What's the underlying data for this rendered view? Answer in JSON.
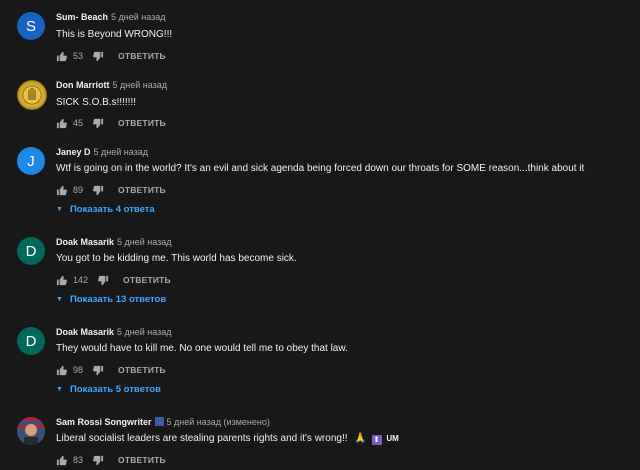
{
  "colors": {
    "background": "#181818",
    "link": "#3ea6ff",
    "avatar_sum": "#1565c0",
    "avatar_janey": "#1e88e5",
    "avatar_doak": "#00695c"
  },
  "comments": [
    {
      "avatar_letter": "S",
      "author": "Sum- Beach",
      "time": "5 дней назад",
      "text": "This is Beyond WRONG!!!",
      "likes": "53",
      "reply_label": "ОТВЕТИТЬ"
    },
    {
      "avatar_letter": "",
      "author": "Don Marriott",
      "time": "5 дней назад",
      "text": "SICK S.O.B.s!!!!!!!",
      "likes": "45",
      "reply_label": "ОТВЕТИТЬ"
    },
    {
      "avatar_letter": "J",
      "author": "Janey D",
      "time": "5 дней назад",
      "text": "Wtf is going on in the world? It's an evil and sick agenda being forced down our throats for SOME reason...think about it",
      "likes": "89",
      "reply_label": "ОТВЕТИТЬ",
      "replies_label": "Показать 4 ответа"
    },
    {
      "avatar_letter": "D",
      "author": "Doak Masarik",
      "time": "5 дней назад",
      "text": "You got to be kidding me. This world has become sick.",
      "likes": "142",
      "reply_label": "ОТВЕТИТЬ",
      "replies_label": "Показать 13 ответов"
    },
    {
      "avatar_letter": "D",
      "author": "Doak Masarik",
      "time": "5 дней назад",
      "text": "They would have to kill me. No one would tell me to obey that law.",
      "likes": "98",
      "reply_label": "ОТВЕТИТЬ",
      "replies_label": "Показать 5 ответов"
    },
    {
      "avatar_letter": "",
      "author": "Sam Rossi Songwriter",
      "time": "5 дней назад (изменено)",
      "text": "Liberal socialist leaders are stealing parents rights and it's wrong!!",
      "text_suffix": "UM",
      "likes": "83",
      "reply_label": "ОТВЕТИТЬ"
    }
  ]
}
